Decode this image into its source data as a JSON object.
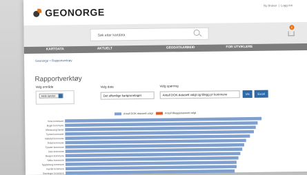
{
  "header": {
    "logo_text": "GEONORGE",
    "top_link_register": "Ny bruker",
    "top_link_login": "Logg inn",
    "search_placeholder": "Søk etter kartdata",
    "cart_count": "0"
  },
  "nav": [
    "KARTDATA",
    "AKTUELT",
    "GEODATAARBEID",
    "FOR UTVIKLERE"
  ],
  "breadcrumb": "Geonorge > Rapportverktøy",
  "page_title": "Rapportverktøy",
  "filters": {
    "area_label": "Velg område",
    "area_tag": "Hele landet",
    "data_label": "Velg data",
    "data_value": "Det offentlige kartgrunnlaget",
    "question_label": "Velg spørring",
    "question_value": "Antall DOK-datasett valgt og tillegg pr kommune",
    "show_button": "Vis",
    "excel_button": "Excel"
  },
  "chart_data": {
    "type": "bar",
    "orientation": "horizontal",
    "series": [
      {
        "name": "Antall DOK-datasett valgt",
        "color": "#7fa0cf",
        "values": [
          100,
          98,
          97,
          96,
          94,
          92,
          91,
          90,
          89,
          88,
          87,
          87,
          86
        ]
      },
      {
        "name": "Antall tilleggsdatasett valgt",
        "color": "#e8581c",
        "values": [
          0,
          0,
          0,
          0,
          0,
          0,
          0,
          0,
          0,
          0,
          0,
          0,
          0
        ]
      }
    ],
    "categories": [
      "Voss kommune",
      "Bygin kommune",
      "Ullensvang herad",
      "Tynset kommune",
      "Vaksdal kommune",
      "Årdal kommune",
      "Tysvær kommune",
      "Oslo kommune",
      "Bergen kommune",
      "Selbu kommune",
      "Spydeberg kommune",
      "Hurdal kommune",
      "Stavanger kommune"
    ]
  }
}
